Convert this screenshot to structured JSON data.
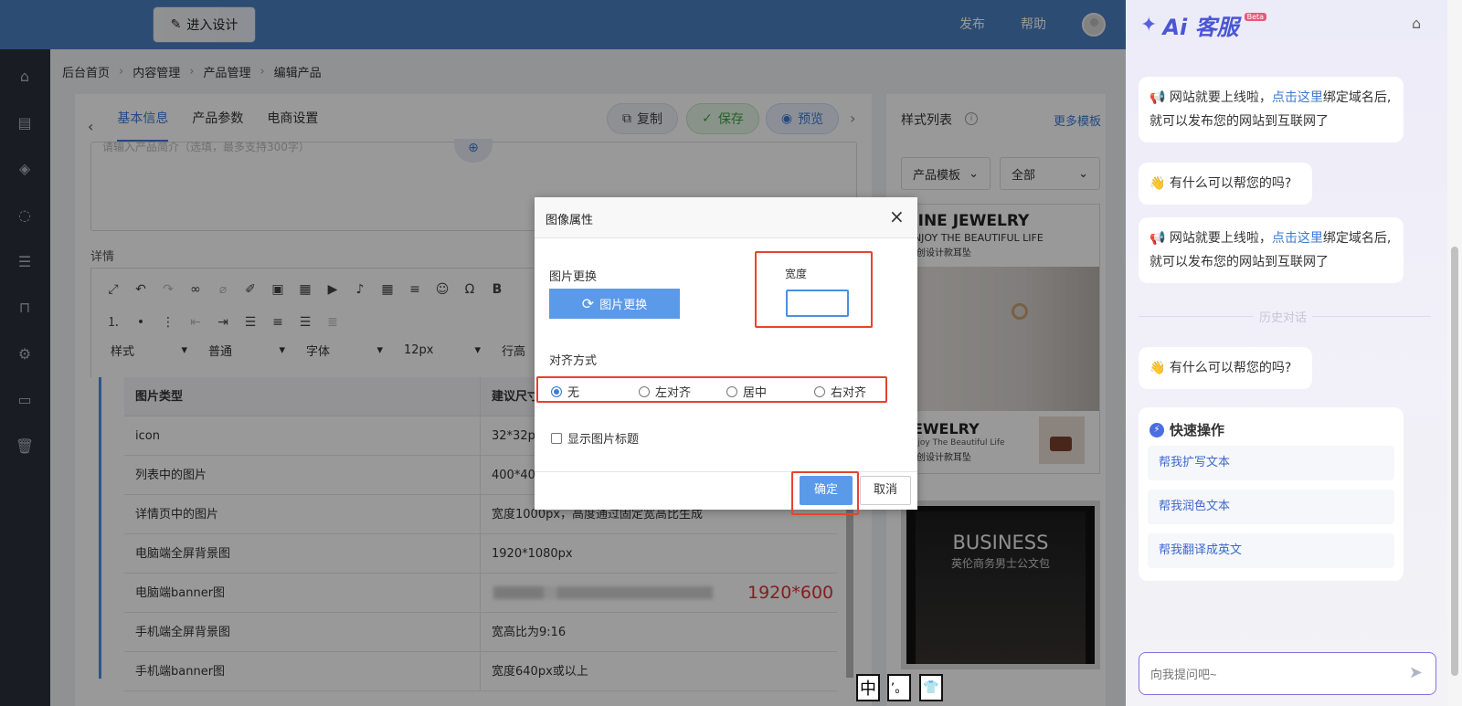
{
  "colors": {
    "topbar": "#4a7fc0",
    "accent": "#3d7ad6",
    "sidebar": "#2b313b",
    "danger": "#e8432e"
  },
  "topbar": {
    "enter_design": "进入设计",
    "publish": "发布",
    "help": "帮助"
  },
  "sidebar": {
    "icons": [
      "home-icon",
      "document-icon",
      "layers-icon",
      "chat-icon",
      "list-icon",
      "bag-icon",
      "gear-icon",
      "terminal-icon",
      "trash-icon"
    ]
  },
  "breadcrumb": [
    "后台首页",
    "内容管理",
    "产品管理",
    "编辑产品"
  ],
  "tabs": [
    "基本信息",
    "产品参数",
    "电商设置"
  ],
  "actions": {
    "copy": "复制",
    "save": "保存",
    "preview": "预览"
  },
  "intro": {
    "placeholder": "请输入产品简介（选填，最多支持300字）"
  },
  "detail_label": "详情",
  "editor": {
    "selects": [
      "样式",
      "普通",
      "字体",
      "12px",
      "行高"
    ]
  },
  "table": {
    "headers": [
      "图片类型",
      "建议尺寸"
    ],
    "rows": [
      [
        "icon",
        "32*32px"
      ],
      [
        "列表中的图片",
        "400*400px"
      ],
      [
        "详情页中的图片",
        "宽度1000px，高度通过固定宽高比生成"
      ],
      [
        "电脑端全屏背景图",
        "1920*1080px"
      ],
      [
        "电脑端banner图",
        ""
      ],
      [
        "手机端全屏背景图",
        "宽高比为9:16"
      ],
      [
        "手机端banner图",
        "宽度640px或以上"
      ]
    ],
    "red_note": "1920*600"
  },
  "style_panel": {
    "title": "样式列表",
    "more": "更多模板",
    "select1": "产品模板",
    "select2": "全部",
    "tpl1": {
      "title": "FINE JEWELRY",
      "subtitle": "ENJOY THE BEAUTIFUL LIFE",
      "cn": "原创设计款耳坠",
      "title2": "JEWELRY",
      "sub2": "Enjoy The Beautiful Life",
      "cn2": "原创设计款耳坠"
    },
    "tpl2": {
      "title": "BUSINESS",
      "cn": "英伦商务男士公文包"
    }
  },
  "dialog": {
    "title": "图像属性",
    "replace_label": "图片更换",
    "replace_btn": "图片更换",
    "width_label": "宽度",
    "width_value": "",
    "align_label": "对齐方式",
    "align_options": [
      "无",
      "左对齐",
      "居中",
      "右对齐"
    ],
    "align_selected": 0,
    "show_caption": "显示图片标题",
    "ok": "确定",
    "cancel": "取消"
  },
  "ai": {
    "brand": "Ai 客服",
    "beta": "Beta",
    "msg1_pre": "网站就要上线啦，",
    "msg1_link": "点击这里",
    "msg1_post": "绑定域名后,就可以发布您的网站到互联网了",
    "msg2": "有什么可以帮您的吗?",
    "history": "历史对话",
    "quick_title": "快速操作",
    "quick": [
      "帮我扩写文本",
      "帮我润色文本",
      "帮我翻译成英文"
    ],
    "input_placeholder": "向我提问吧~"
  },
  "ime": [
    "中",
    "’。",
    "👕"
  ]
}
